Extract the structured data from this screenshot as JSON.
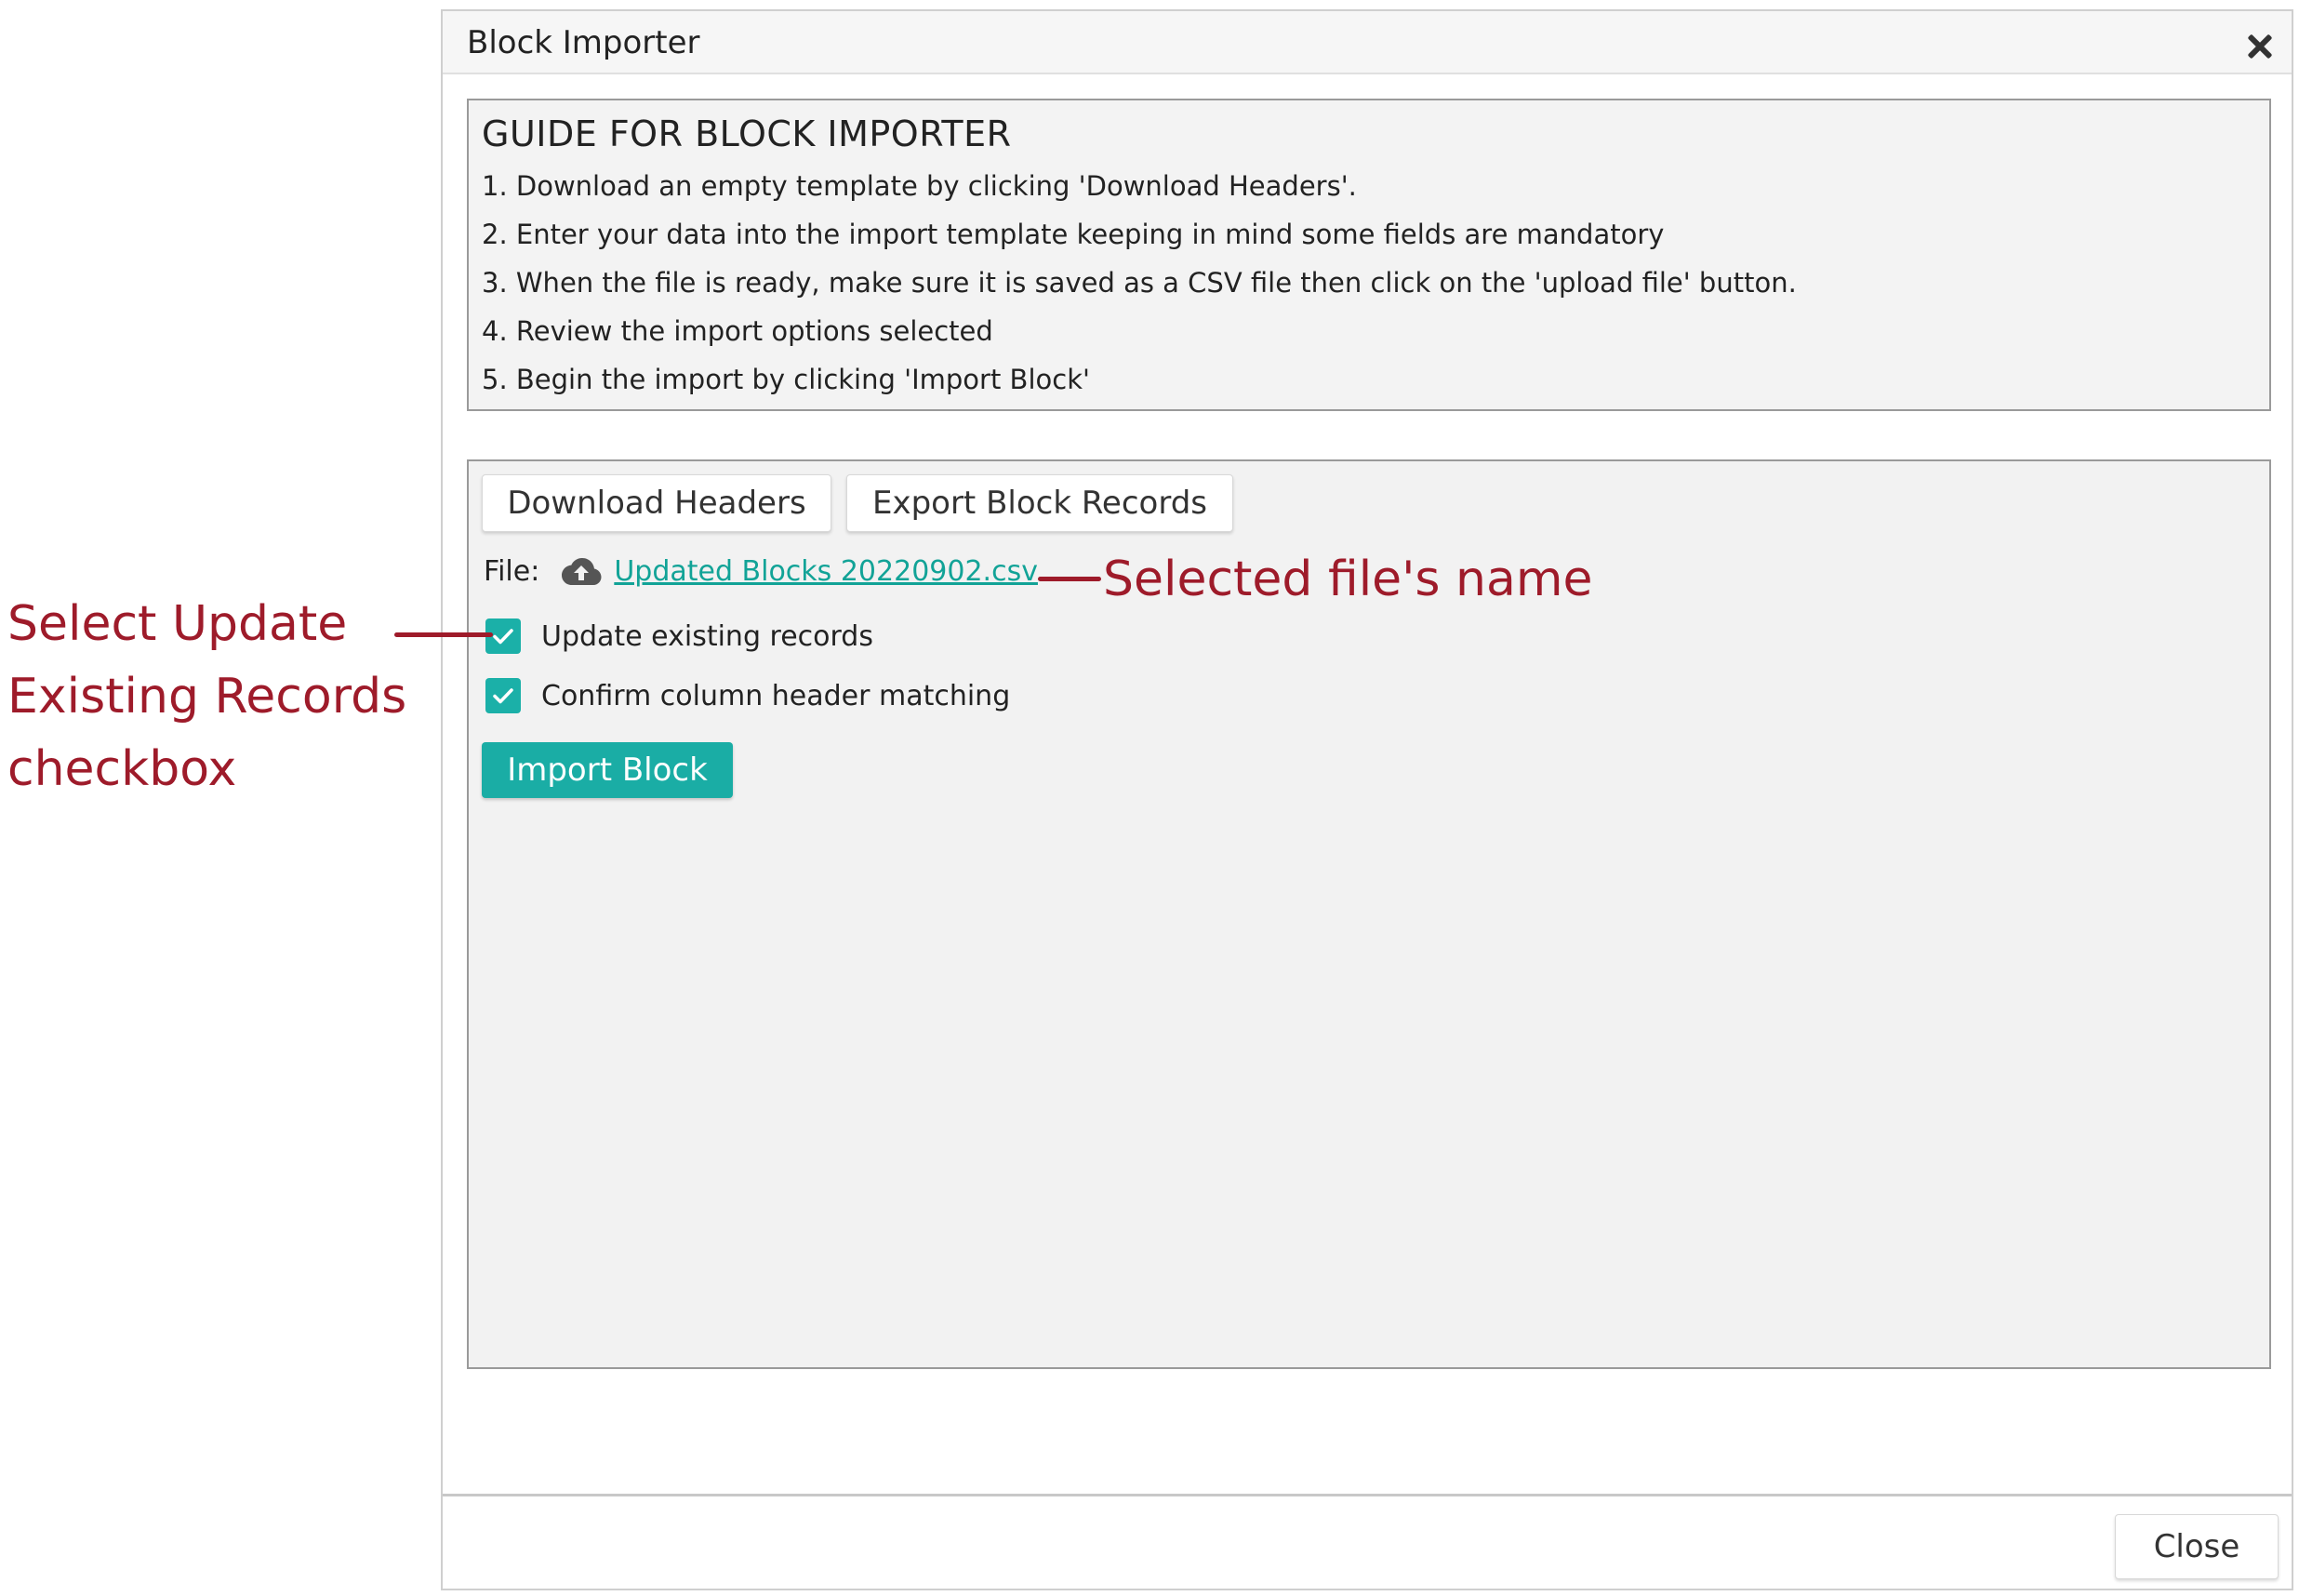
{
  "dialog": {
    "title": "Block Importer",
    "close_icon": "close-icon"
  },
  "guide": {
    "title": "GUIDE FOR BLOCK IMPORTER",
    "steps": [
      "1. Download an empty template by clicking 'Download Headers'.",
      "2. Enter your data into the import template keeping in mind some fields are mandatory",
      "3. When the file is ready, make sure it is saved as a CSV file then click on the 'upload file' button.",
      "4. Review the import options selected",
      "5. Begin the import by clicking 'Import Block'"
    ]
  },
  "panel": {
    "download_headers_label": "Download Headers",
    "export_records_label": "Export Block Records",
    "file_label": "File:",
    "upload_icon": "cloud-upload-icon",
    "file_name": "Updated Blocks 20220902.csv",
    "update_existing_label": "Update existing records",
    "update_existing_checked": true,
    "confirm_header_label": "Confirm column header matching",
    "confirm_header_checked": true,
    "import_label": "Import Block"
  },
  "footer": {
    "close_label": "Close"
  },
  "annotations": {
    "left_line1": "Select Update",
    "left_line2": "Existing Records",
    "left_line3": "checkbox",
    "right_text": "Selected file's name"
  },
  "colors": {
    "accent": "#1aada5",
    "link": "#12a397",
    "annotation": "#9e1b2a"
  }
}
